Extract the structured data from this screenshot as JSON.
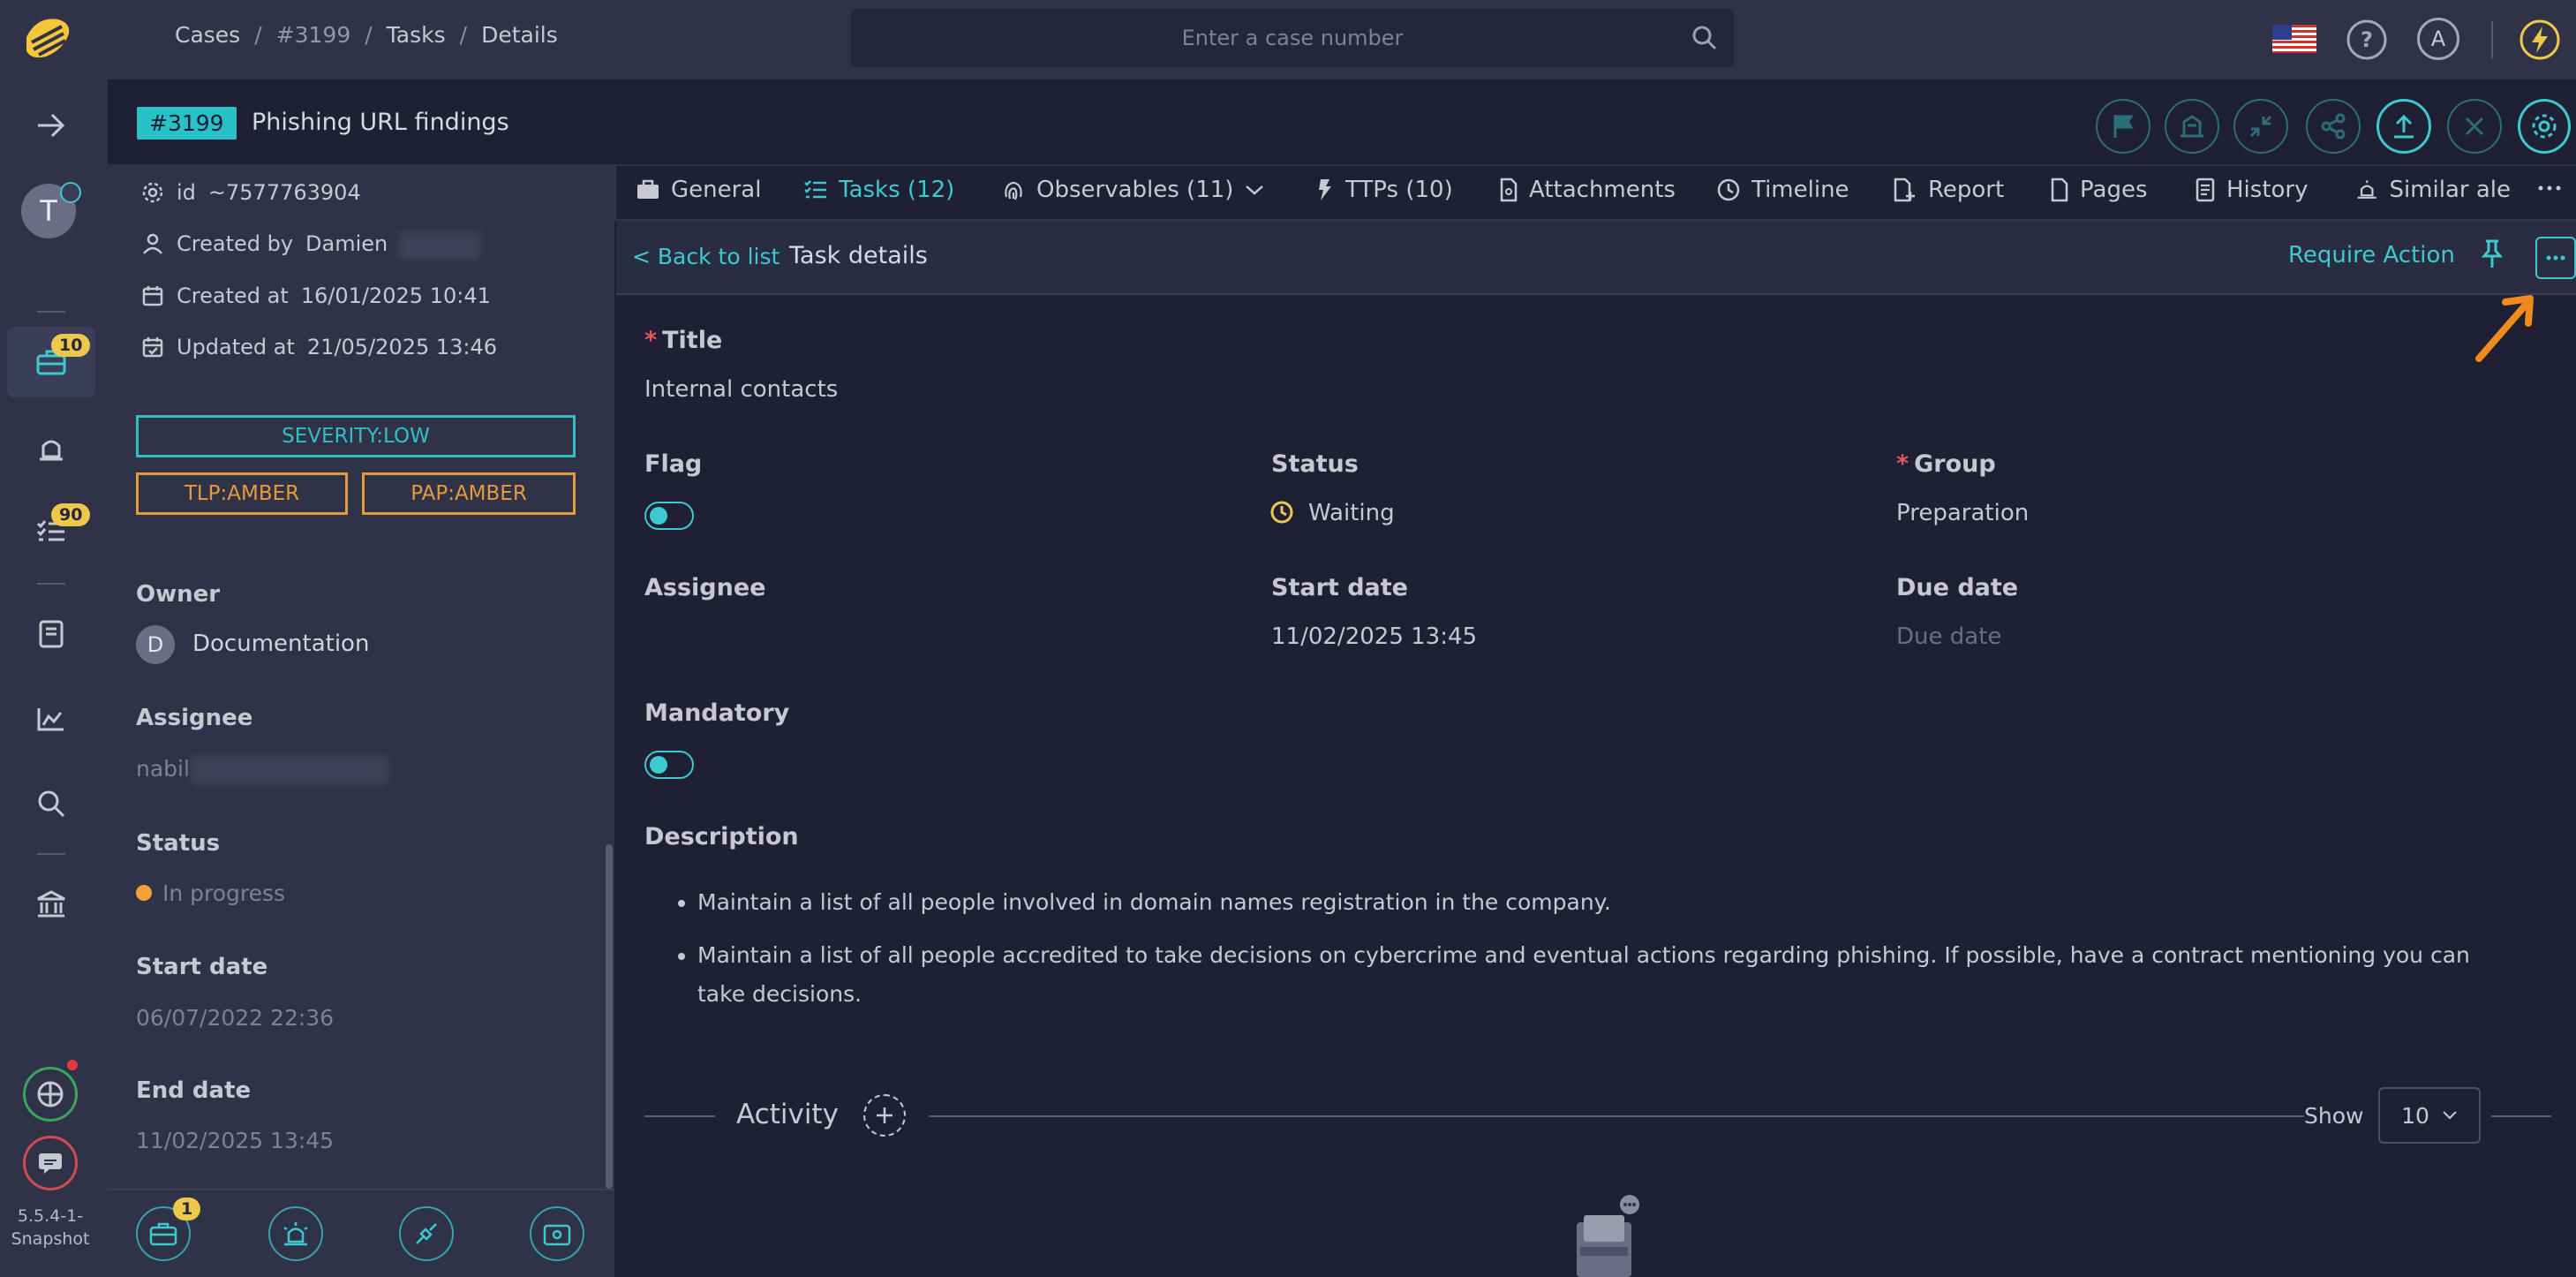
{
  "topbar": {
    "breadcrumb": [
      "Cases",
      "#3199",
      "Tasks",
      "Details"
    ],
    "search_placeholder": "Enter a case number",
    "user_initial": "A"
  },
  "rail": {
    "user_initial": "T",
    "cases_badge": "10",
    "tasks_badge": "90",
    "version": "5.5.4-1-Snapshot"
  },
  "case": {
    "number": "#3199",
    "title": "Phishing URL findings"
  },
  "left_panel": {
    "id_label": "id",
    "id_value": "~7577763904",
    "created_by_label": "Created by",
    "created_by_value": "Damien",
    "created_at_label": "Created at",
    "created_at_value": "16/01/2025 10:41",
    "updated_at_label": "Updated at",
    "updated_at_value": "21/05/2025 13:46",
    "severity": "SEVERITY:LOW",
    "tlp": "TLP:AMBER",
    "pap": "PAP:AMBER",
    "owner_label": "Owner",
    "owner_initial": "D",
    "owner_name": "Documentation",
    "assignee_label": "Assignee",
    "assignee_value": "nabil",
    "status_label": "Status",
    "status_value": "In progress",
    "start_label": "Start date",
    "start_value": "06/07/2022 22:36",
    "end_label": "End date",
    "end_value": "11/02/2025 13:45",
    "bottom_badge": "1"
  },
  "tabs": [
    {
      "label": "General"
    },
    {
      "label": "Tasks (12)"
    },
    {
      "label": "Observables (11)"
    },
    {
      "label": "TTPs (10)"
    },
    {
      "label": "Attachments"
    },
    {
      "label": "Timeline"
    },
    {
      "label": "Report"
    },
    {
      "label": "Pages"
    },
    {
      "label": "History"
    },
    {
      "label": "Similar ale"
    }
  ],
  "task": {
    "back_label": "< Back to list",
    "heading": "Task details",
    "require_action": "Require Action",
    "title_label": "Title",
    "title_value": "Internal contacts",
    "flag_label": "Flag",
    "flag_on": true,
    "status_label": "Status",
    "status_value": "Waiting",
    "group_label": "Group",
    "group_value": "Preparation",
    "assignee_label": "Assignee",
    "start_label": "Start date",
    "start_value": "11/02/2025 13:45",
    "due_label": "Due date",
    "due_placeholder": "Due date",
    "mandatory_label": "Mandatory",
    "mandatory_on": true,
    "description_label": "Description",
    "description_items": [
      "Maintain a list of all people involved in domain names registration in the company.",
      "Maintain a list of all people accredited to take decisions on cybercrime and eventual actions regarding phishing. If possible, have a contract mentioning you can take decisions."
    ]
  },
  "activity": {
    "title": "Activity",
    "show_label": "Show",
    "show_value": "10"
  },
  "colors": {
    "accent": "#3cc9d0",
    "amber": "#e79a3b",
    "badge": "#ecc94b",
    "background": "#1f2034",
    "panel": "#303247"
  }
}
